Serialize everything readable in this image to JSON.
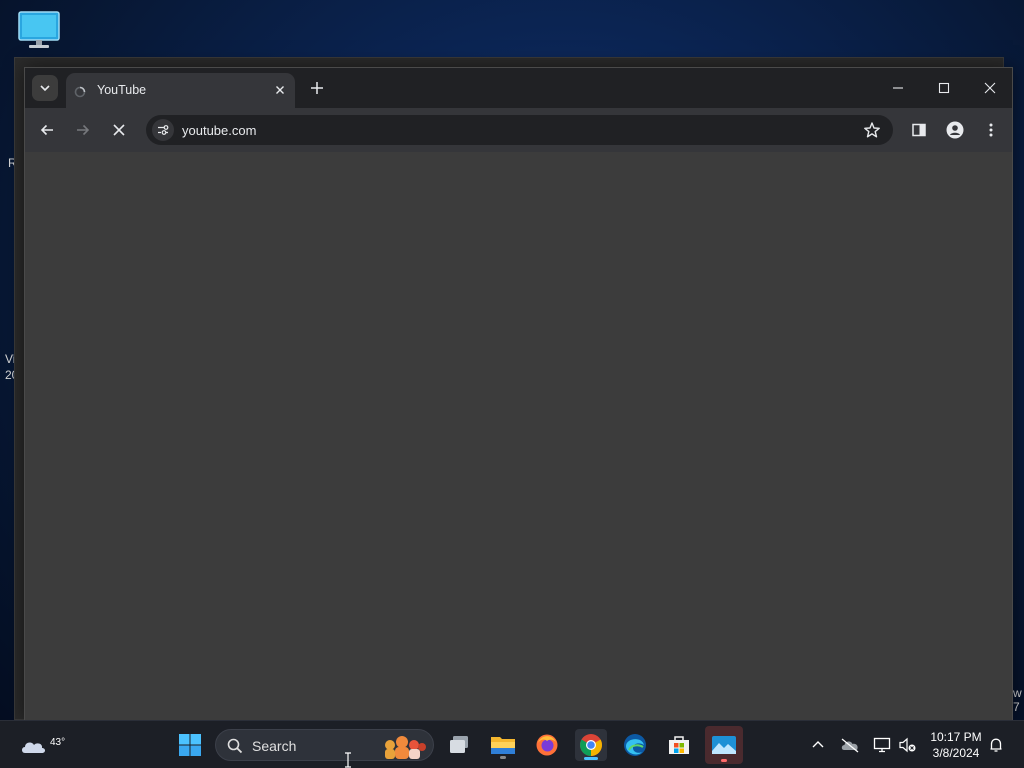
{
  "desktop": {
    "icon": "this-pc-icon",
    "edge_fragments": [
      "R",
      "Vi",
      "20",
      "w",
      "7"
    ]
  },
  "browser": {
    "tab": {
      "title": "YouTube",
      "favicon": "loading-favicon-icon"
    },
    "address": {
      "url": "youtube.com"
    },
    "icons": [
      "tab-search-icon",
      "close-tab-icon",
      "new-tab-icon",
      "minimize-icon",
      "maximize-icon",
      "close-window-icon",
      "back-icon",
      "forward-icon",
      "stop-loading-icon",
      "site-info-icon",
      "bookmark-star-icon",
      "side-panel-icon",
      "profile-icon",
      "menu-icon"
    ]
  },
  "taskbar": {
    "weather": {
      "temp": "43°"
    },
    "search": {
      "label": "Search"
    },
    "apps": [
      "start-icon",
      "task-view-icon",
      "file-explorer-icon",
      "firefox-icon",
      "chrome-icon",
      "edge-icon",
      "microsoft-store-icon",
      "photos-icon"
    ],
    "tray": [
      "show-hidden-icon",
      "onedrive-icon",
      "network-icon",
      "volume-muted-icon",
      "notifications-icon"
    ],
    "clock": {
      "time": "10:17 PM",
      "date": "3/8/2024"
    }
  },
  "colors": {
    "accent": "#4cc2ff",
    "browser_frame": "#202124",
    "toolbar": "#35363a",
    "page": "#3c3c3c"
  }
}
